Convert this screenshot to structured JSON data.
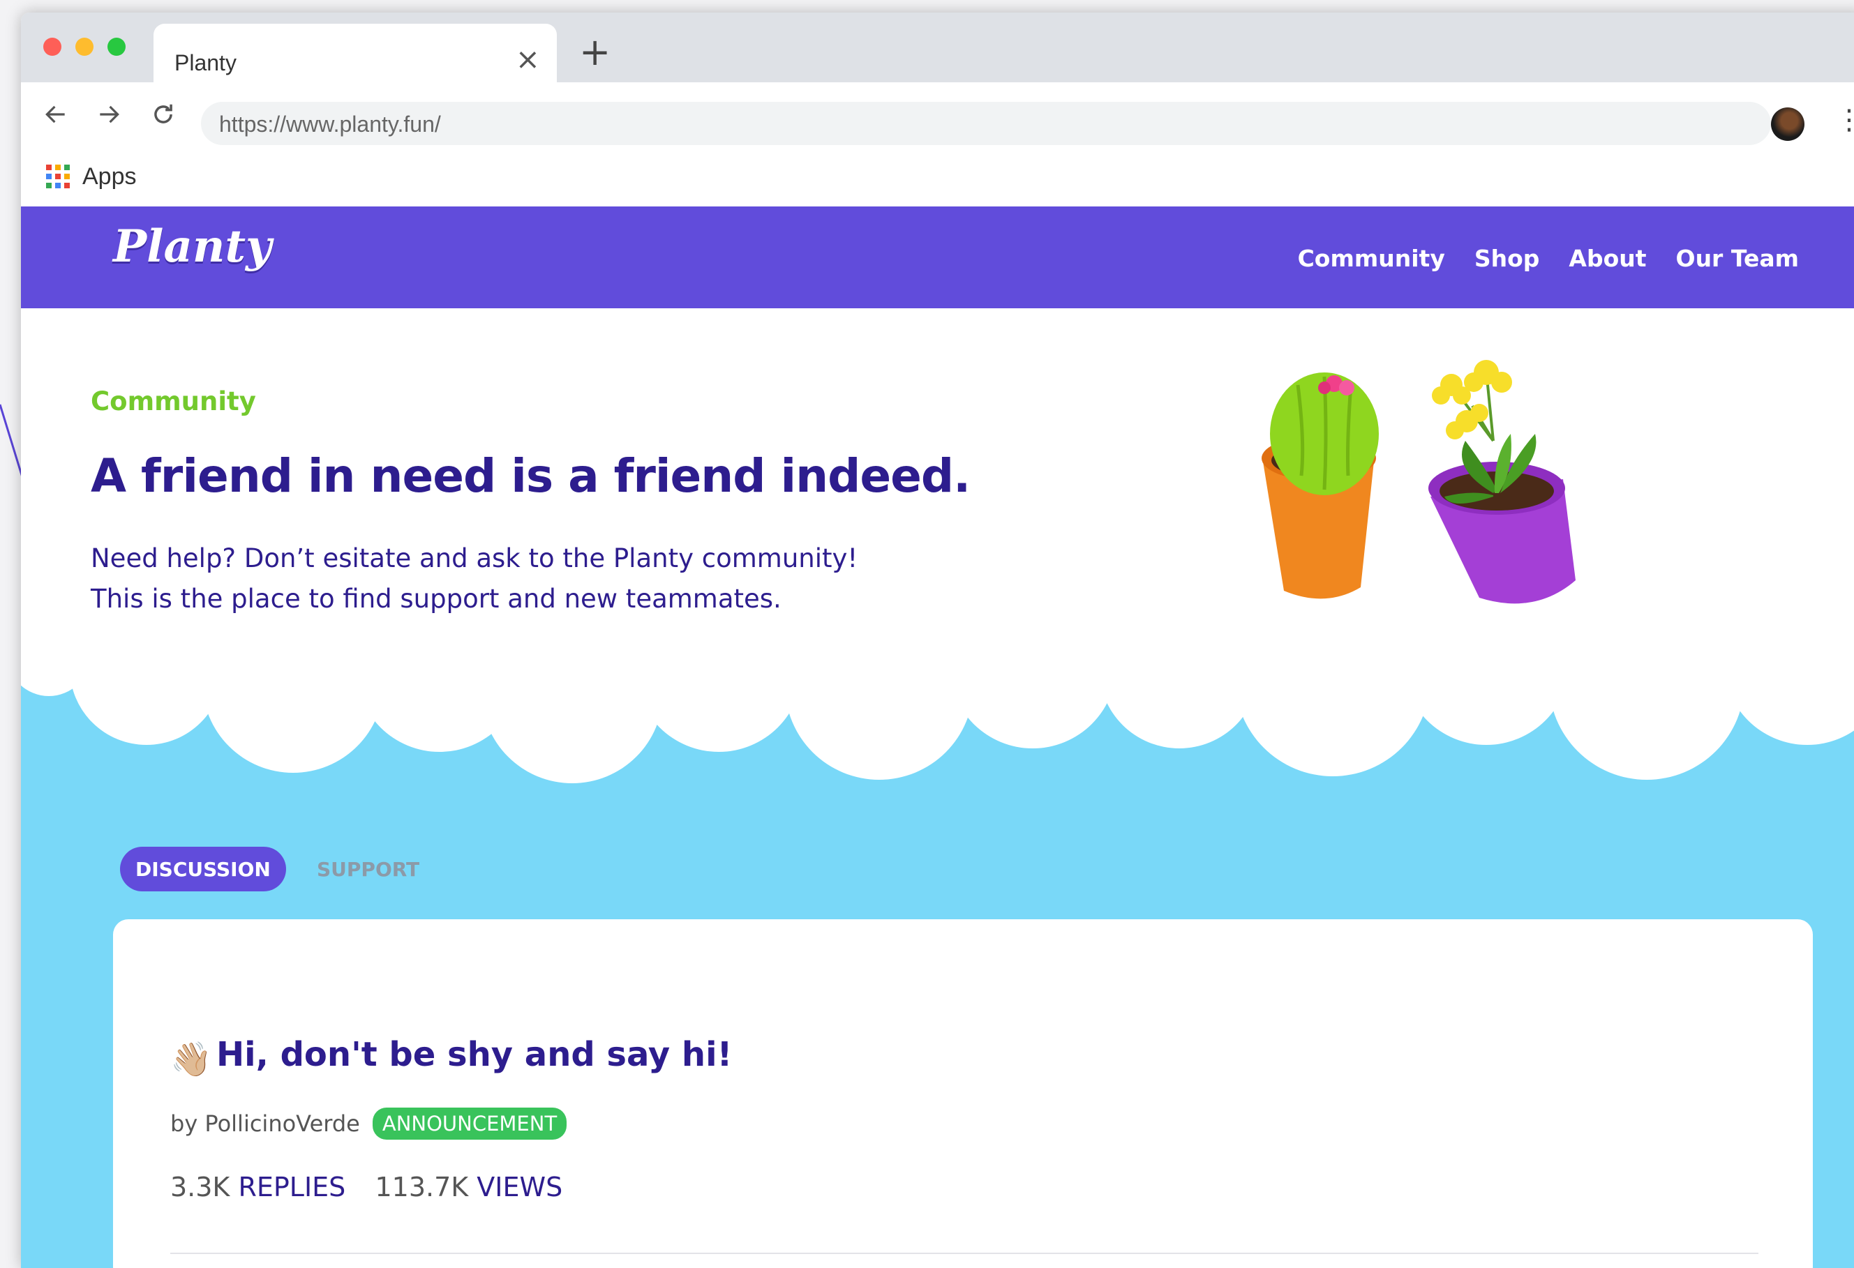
{
  "browser": {
    "tab_title": "Planty",
    "tab_close": "×",
    "new_tab": "+",
    "url": "https://www.planty.fun/",
    "menu": "⋮",
    "bookmarks": {
      "apps_label": "Apps"
    }
  },
  "site": {
    "logo": "Planty",
    "nav": [
      "Community",
      "Shop",
      "About",
      "Our Team"
    ]
  },
  "hero": {
    "eyebrow": "Community",
    "headline": "A friend in need is a friend indeed.",
    "lede_line1": "Need help? Don’t esitate and ask to the Planty community!",
    "lede_line2": "This is the place to find support and new teammates."
  },
  "tabs": {
    "discussion": "DISCUSSION",
    "support": "SUPPORT"
  },
  "post": {
    "emoji": "👋🏼",
    "title": "Hi, don't be shy and say hi!",
    "author": "by PollicinoVerde",
    "badge": "ANNOUNCEMENT",
    "replies_count": "3.3K",
    "replies_label": "REPLIES",
    "views_count": "113.7K",
    "views_label": "VIEWS"
  },
  "colors": {
    "brand_purple": "#614cdb",
    "title_navy": "#2d1d8e",
    "accent_green": "#73c92d",
    "sky_blue": "#79d8f8",
    "badge_green": "#39c35b"
  },
  "icons": [
    "back-arrow-icon",
    "forward-arrow-icon",
    "reload-icon",
    "apps-grid-icon",
    "profile-avatar",
    "kebab-menu-icon",
    "waving-hand-emoji"
  ]
}
